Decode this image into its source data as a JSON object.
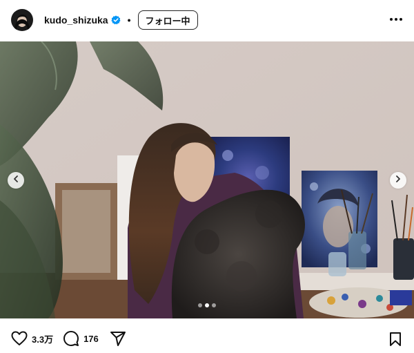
{
  "post": {
    "username": "kudo_shizuka",
    "follow_label": "フォロー中",
    "separator": "•"
  },
  "carousel": {
    "slide_count": 3,
    "active_index": 0
  },
  "actions": {
    "likes": "3.3万",
    "comments": "176"
  },
  "icons": {
    "verified": "verified-badge-icon",
    "more": "more-options-icon",
    "prev": "chevron-left-icon",
    "next": "chevron-right-icon",
    "like": "heart-icon",
    "comment": "comment-bubble-icon",
    "share": "paper-plane-icon",
    "save": "bookmark-icon"
  },
  "colors": {
    "verified_blue": "#0095f6",
    "text": "#111111"
  }
}
